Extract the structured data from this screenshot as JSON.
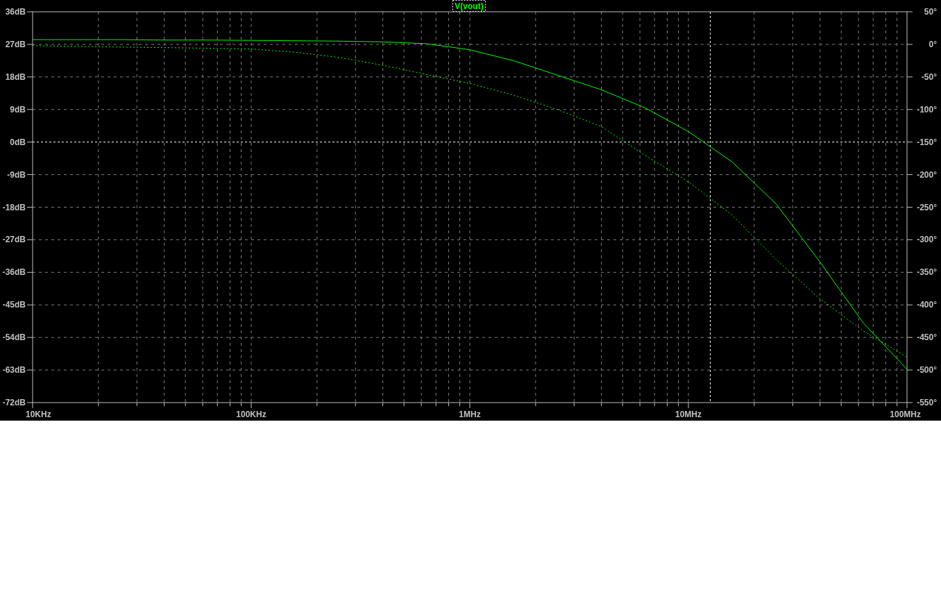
{
  "plot": {
    "magnitude_chart": {
      "chart_data": {
        "type": "line",
        "title": "V(vout)",
        "grid": true,
        "categories": [
          "10KHz",
          null,
          null,
          null,
          null,
          "100KHz",
          null,
          null,
          null,
          null,
          "1MHz",
          null,
          null,
          null,
          null,
          "10MHz",
          null,
          null,
          null,
          null,
          "100MHz"
        ],
        "ylim": [
          -72,
          36
        ],
        "yticks": [
          {
            "value": 36,
            "label": "36dB"
          },
          {
            "value": 27,
            "label": "27dB"
          },
          {
            "value": 18,
            "label": "18dB"
          },
          {
            "value": 9,
            "label": "9dB"
          },
          {
            "value": 0,
            "label": "0dB"
          },
          {
            "value": -9,
            "label": "-9dB"
          },
          {
            "value": -18,
            "label": "-18dB"
          },
          {
            "value": -27,
            "label": "-27dB"
          },
          {
            "value": -36,
            "label": "-36dB"
          },
          {
            "value": -45,
            "label": "-45dB"
          },
          {
            "value": -54,
            "label": "-54dB"
          },
          {
            "value": -63,
            "label": "-63dB"
          },
          {
            "value": -72,
            "label": "-72dB"
          }
        ],
        "series": [
          {
            "color": "#00ff00",
            "line_style": "solid",
            "values": [
              28.3,
              28.3,
              28.3,
              28.2,
              28.2,
              28.1,
              28.0,
              27.9,
              27.7,
              27.2,
              25.5,
              22.5,
              18.5,
              14.5,
              9.5,
              2.9,
              -5.5,
              -17,
              -33,
              -50,
              -62.8
            ]
          }
        ]
      }
    },
    "phase_chart": {
      "chart_data": {
        "type": "line",
        "categories": [
          null,
          null,
          null,
          null,
          null,
          null,
          null,
          null,
          null,
          null,
          null,
          null,
          null,
          null,
          null,
          null,
          null,
          null,
          null,
          null,
          null
        ],
        "ylim": [
          -550,
          50
        ],
        "yticks": [
          {
            "value": 50,
            "label": "50°"
          },
          {
            "value": 0,
            "label": "0°"
          },
          {
            "value": -50,
            "label": "-50°"
          },
          {
            "value": -100,
            "label": "-100°"
          },
          {
            "value": -150,
            "label": "-150°"
          },
          {
            "value": -200,
            "label": "-200°"
          },
          {
            "value": -250,
            "label": "-250°"
          },
          {
            "value": -300,
            "label": "-300°"
          },
          {
            "value": -350,
            "label": "-350°"
          },
          {
            "value": -400,
            "label": "-400°"
          },
          {
            "value": -450,
            "label": "-450°"
          },
          {
            "value": -500,
            "label": "-500°"
          },
          {
            "value": -550,
            "label": "-550°"
          }
        ],
        "series": [
          {
            "color": "#00ff00",
            "line_style": "dashed",
            "values": [
              -2,
              -3,
              -4,
              -5,
              -6,
              -7,
              -12,
              -20,
              -32,
              -46,
              -60,
              -78,
              -100,
              -126,
              -170,
              -211,
              -262,
              -330,
              -390,
              -440,
              -480
            ]
          }
        ]
      }
    }
  }
}
